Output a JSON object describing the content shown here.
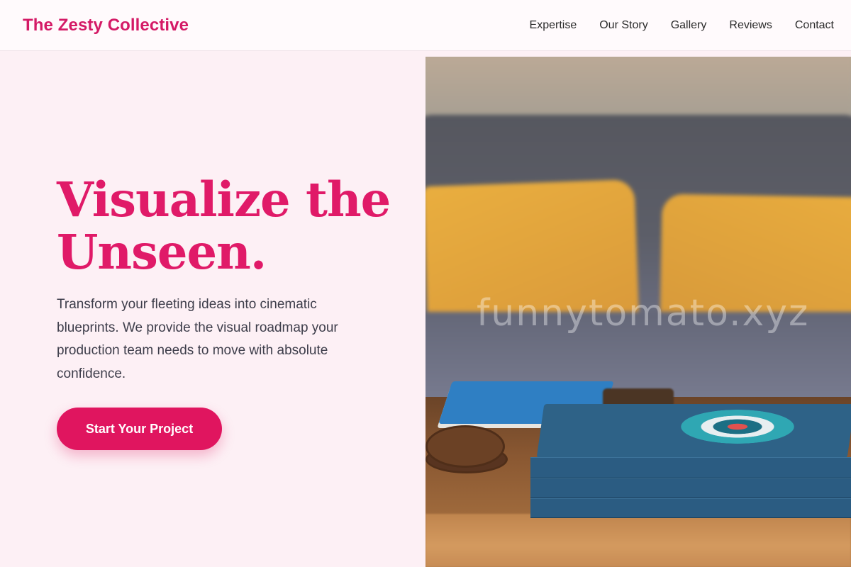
{
  "nav": {
    "brand": "The Zesty Collective",
    "links": [
      "Expertise",
      "Our Story",
      "Gallery",
      "Reviews",
      "Contact"
    ]
  },
  "hero": {
    "title": "Visualize the Unseen.",
    "description": "Transform your fleeting ideas into cinematic blueprints. We provide the visual roadmap your production team needs to move with absolute confidence.",
    "cta_label": "Start Your Project"
  },
  "photo": {
    "watermark": "funnytomato.xyz"
  },
  "colors": {
    "accent": "#e0155f",
    "brand": "#d41a66",
    "background": "#fdf0f5"
  }
}
